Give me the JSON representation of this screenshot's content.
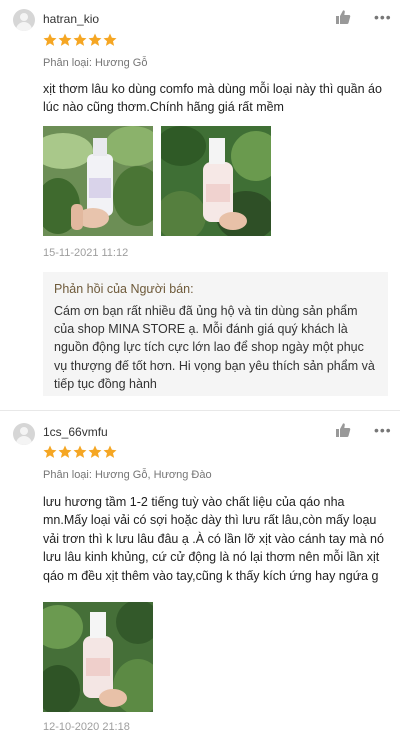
{
  "reviews": [
    {
      "username": "hatran_kio",
      "rating": 5,
      "variant": "Phân loại: Hương Gỗ",
      "content": "xịt thơm lâu ko dùng comfo mà dùng mỗi loại này thì quần áo lúc nào cũng thơm.Chính hãng giá rất mềm",
      "timestamp": "15-11-2021 11:12",
      "seller_reply": {
        "title": "Phản hồi của Người bán:",
        "text": "Cám ơn bạn rất nhiều đã ủng hộ và tin dùng sản phẩm của shop MINA STORE ạ. Mỗi đánh giá  quý khách là nguồn động lực tích cực lớn lao để shop ngày một phục vụ thượng đế tốt hơn. Hi vọng bạn yêu thích sản phẩm và tiếp tục đồng hành"
      }
    },
    {
      "username": "1cs_66vmfu",
      "rating": 5,
      "variant": "Phân loại: Hương Gỗ, Hương Đào",
      "content": "lưu hương tầm 1-2 tiếng tuỳ vào chất liệu của qáo nha mn.Mấy loại vải có sợi hoặc dày thì lưu rất lâu,còn mấy loạu vải trơn thì k lưu lâu đâu ạ .À có lần lỡ xịt vào cánh tay mà nó lưu lâu kinh khủng, cứ cử động là nó lại thơm nên mỗi lần xịt qáo m đều xịt thêm vào tay,cũng k thấy kích ứng hay ngứa g",
      "timestamp": "12-10-2020 21:18"
    }
  ],
  "icons": {
    "avatar": "user-avatar-icon",
    "like": "thumbs-up-icon",
    "more": "more-options-icon",
    "star": "star-icon"
  },
  "colors": {
    "star": "#f5a623",
    "reply_bg": "#f5f5f5",
    "reply_title": "#6e5a3a"
  }
}
